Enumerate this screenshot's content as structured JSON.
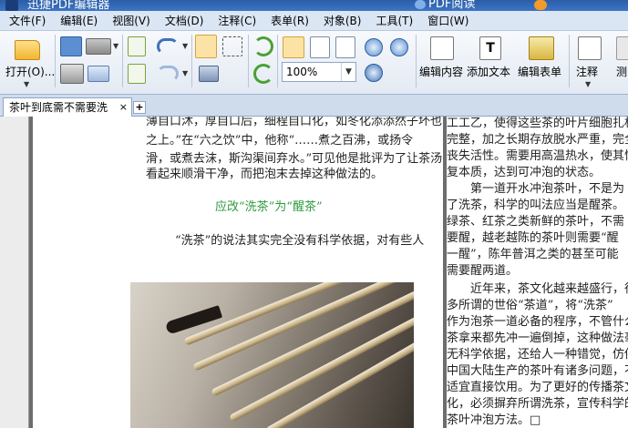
{
  "titlebar": {
    "title": "迅捷PDF编辑器",
    "brand": "PDF阅读"
  },
  "menu": [
    "文件(F)",
    "编辑(E)",
    "视图(V)",
    "文档(D)",
    "注释(C)",
    "表单(R)",
    "对象(B)",
    "工具(T)",
    "窗口(W)"
  ],
  "toolbar": {
    "open_label": "打开(O)...",
    "zoom_value": "100%",
    "edit_content_label": "编辑内容",
    "add_text_label": "添加文本",
    "edit_form_label": "编辑表单",
    "comment_label": "注释",
    "measure_label": "测"
  },
  "tabs": [
    {
      "label": "茶叶到底需不需要洗",
      "close": "×"
    }
  ],
  "new_tab": "+",
  "page1": {
    "lines": [
      "薄自口沐，厚自口后，细程自口化，如冬化添添然子坏也",
      "之上。”在“六之饮”中，他称“……煮之百沸，或扬令",
      "滑，或煮去沫，斯沟渠间弃水。”可见他是批评为了让茶汤",
      "看起来顺滑干净，而把泡末去掉这种做法的。"
    ],
    "heading": "应改“洗茶”为“醒茶”",
    "para": "“洗茶”的说法其实完全没有科学依据，对有些人"
  },
  "page2": {
    "lines": [
      "工工乙，使得这些茶的叶片细胞扎权",
      "完整，加之长期存放脱水严重，完全",
      "丧失活性。需要用高温热水，使其恢",
      "复本质，达到可冲泡的状态。",
      "　　第一道开水冲泡茶叶，不是为",
      "了洗茶，科学的叫法应当是醒茶。",
      "绿茶、红茶之类新鲜的茶叶，不需",
      "要醒，越老越陈的茶叶则需要“醒",
      "一醒”，陈年普洱之类的甚至可能",
      "需要醒两道。",
      "　　近年来，茶文化越来越盛行，很",
      "多所谓的世俗“茶道”，将“洗茶”",
      "作为泡茶一道必备的程序，不管什么",
      "茶拿来都先冲一遍倒掉，这种做法毫",
      "无科学依据，还给人一种错觉，仿佛",
      "中国大陆生产的茶叶有诸多问题，不",
      "适宜直接饮用。为了更好的传播茶文",
      "化，必须摒弃所谓洗茶，宣传科学的",
      "茶叶冲泡方法。□"
    ]
  }
}
